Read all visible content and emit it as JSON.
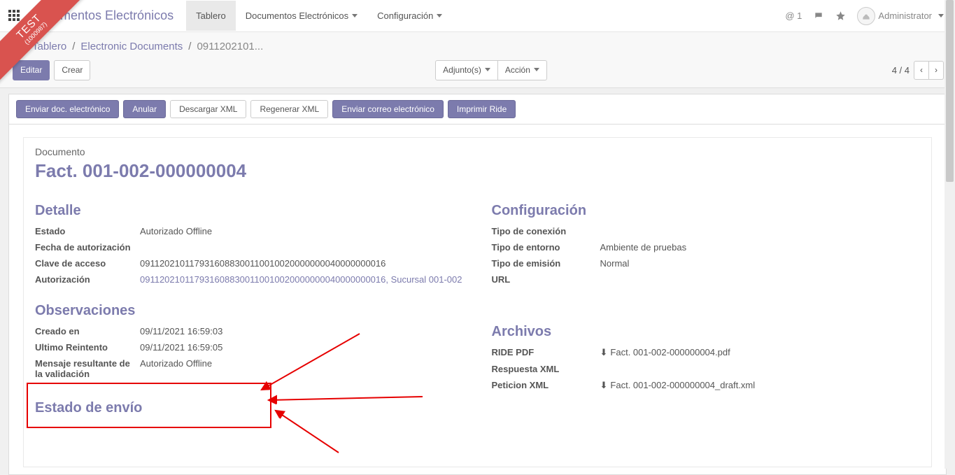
{
  "ribbon": {
    "line1": "TEST",
    "line2": "(1000987)"
  },
  "topnav": {
    "brand": "Documentos Electrónicos",
    "tabs": {
      "tablero": "Tablero",
      "docs": "Documentos Electrónicos",
      "config": "Configuración"
    },
    "at_count": "@ 1",
    "user": "Administrator"
  },
  "breadcrumb": {
    "tablero": "Tablero",
    "edocs": "Electronic Documents",
    "current": "0911202101..."
  },
  "cp": {
    "editar": "Editar",
    "crear": "Crear",
    "adjuntos": "Adjunto(s)",
    "accion": "Acción",
    "pager": "4 / 4"
  },
  "statusbar": {
    "send": "Enviar doc. electrónico",
    "anular": "Anular",
    "descargar": "Descargar XML",
    "regenerar": "Regenerar XML",
    "correo": "Enviar correo electrónico",
    "ride": "Imprimir Ride"
  },
  "doc": {
    "label": "Documento",
    "title": "Fact. 001-002-000000004"
  },
  "sections": {
    "detalle": "Detalle",
    "configuracion": "Configuración",
    "observaciones": "Observaciones",
    "archivos": "Archivos",
    "envio": "Estado de envío"
  },
  "detalle": {
    "estado_l": "Estado",
    "estado_v": "Autorizado Offline",
    "fecha_l": "Fecha de autorización",
    "fecha_v": "",
    "clave_l": "Clave de acceso",
    "clave_v": "0911202101179316088300110010020000000040000000016",
    "auth_l": "Autorización",
    "auth_v": "0911202101179316088300110010020000000040000000016, Sucursal 001-002"
  },
  "config": {
    "conex_l": "Tipo de conexión",
    "conex_v": "",
    "entorno_l": "Tipo de entorno",
    "entorno_v": "Ambiente de pruebas",
    "emision_l": "Tipo de emisión",
    "emision_v": "Normal",
    "url_l": "URL",
    "url_v": ""
  },
  "obs": {
    "creado_l": "Creado en",
    "creado_v": "09/11/2021 16:59:03",
    "reint_l": "Ultimo Reintento",
    "reint_v": "09/11/2021 16:59:05",
    "msg_l": "Mensaje resultante de la validación",
    "msg_v": "Autorizado Offline"
  },
  "archivos": {
    "ride_l": "RIDE PDF",
    "ride_v": "Fact. 001-002-000000004.pdf",
    "resp_l": "Respuesta XML",
    "resp_v": "",
    "pet_l": "Peticion XML",
    "pet_v": "Fact. 001-002-000000004_draft.xml"
  }
}
